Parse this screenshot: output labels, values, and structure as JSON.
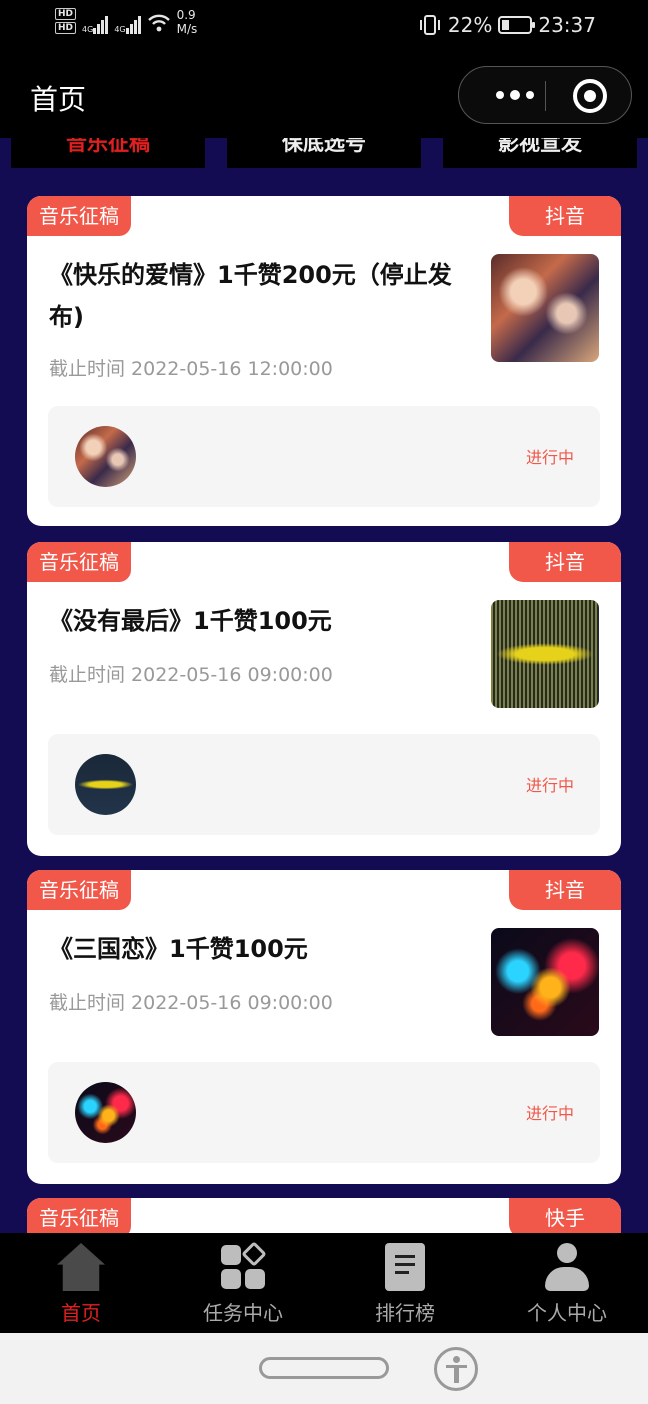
{
  "status_bar": {
    "hd1": "HD",
    "hd2": "HD",
    "net1": "4G",
    "net2": "4G",
    "speed_value": "0.9",
    "speed_unit": "M/s",
    "battery": "22%",
    "time": "23:37"
  },
  "nav": {
    "title": "首页"
  },
  "top_tabs": [
    {
      "label": "音乐征稿"
    },
    {
      "label": "保底选号"
    },
    {
      "label": "影视宣发"
    }
  ],
  "cards": [
    {
      "category": "音乐征稿",
      "platform": "抖音",
      "title": "《快乐的爱情》1千赞200元（停止发布)",
      "deadline": "截止时间 2022-05-16 12:00:00",
      "status": "进行中"
    },
    {
      "category": "音乐征稿",
      "platform": "抖音",
      "title": "《没有最后》1千赞100元",
      "deadline": "截止时间 2022-05-16 09:00:00",
      "status": "进行中"
    },
    {
      "category": "音乐征稿",
      "platform": "抖音",
      "title": "《三国恋》1千赞100元",
      "deadline": "截止时间 2022-05-16 09:00:00",
      "status": "进行中"
    },
    {
      "category": "音乐征稿",
      "platform": "快手"
    }
  ],
  "tab_bar": [
    {
      "label": "首页",
      "icon": "home-icon",
      "active": true
    },
    {
      "label": "任务中心",
      "icon": "grid-icon",
      "active": false
    },
    {
      "label": "排行榜",
      "icon": "document-icon",
      "active": false
    },
    {
      "label": "个人中心",
      "icon": "user-icon",
      "active": false
    }
  ],
  "colors": {
    "accent": "#f1584a",
    "active_tab": "#e02020",
    "content_bg": "#140c52"
  }
}
